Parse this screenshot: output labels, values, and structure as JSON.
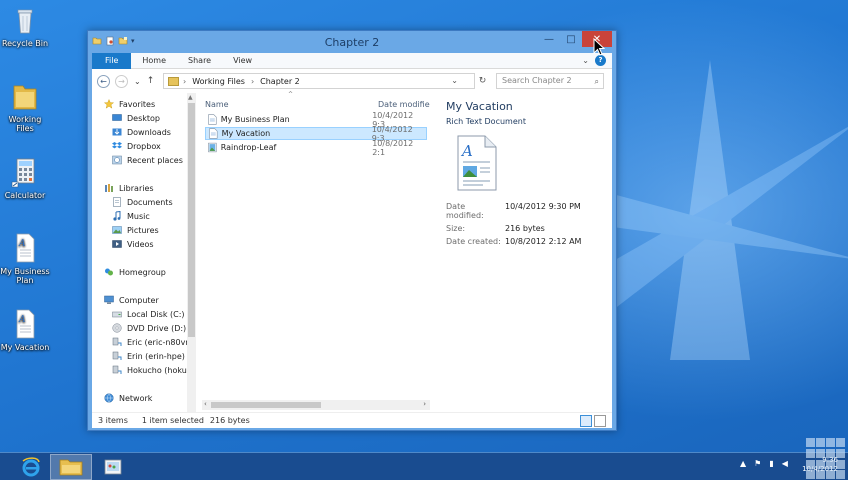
{
  "desktop": {
    "icons": [
      {
        "label": "Recycle Bin"
      },
      {
        "label": "Working Files"
      },
      {
        "label": "Calculator"
      },
      {
        "label": "My Business Plan"
      },
      {
        "label": "My Vacation"
      }
    ]
  },
  "window": {
    "title": "Chapter 2",
    "minimize": "—",
    "maximize": "□",
    "close": "✕"
  },
  "ribbon": {
    "tabs": [
      "File",
      "Home",
      "Share",
      "View"
    ],
    "expand": "⌄",
    "help": "?"
  },
  "address": {
    "back": "←",
    "forward": "→",
    "recent": "⌄",
    "up": "↑",
    "crumbs": [
      "Working Files",
      "Chapter 2"
    ],
    "separator": "›",
    "dropdown": "⌄",
    "refresh": "↻",
    "search_placeholder": "Search Chapter 2",
    "search_icon": "⌕"
  },
  "nav": {
    "favorites": "Favorites",
    "favorites_items": [
      "Desktop",
      "Downloads",
      "Dropbox",
      "Recent places"
    ],
    "libraries": "Libraries",
    "libraries_items": [
      "Documents",
      "Music",
      "Pictures",
      "Videos"
    ],
    "homegroup": "Homegroup",
    "computer": "Computer",
    "computer_items": [
      "Local Disk (C:)",
      "DVD Drive (D:) O!",
      "Eric (eric-n80vn)",
      "Erin (erin-hpe)",
      "Hokucho (hokuc"
    ],
    "network": "Network",
    "scroll_up": "▲"
  },
  "files": {
    "col_name": "Name",
    "col_date": "Date modifie",
    "sort_glyph": "^",
    "rows": [
      {
        "name": "My Business Plan",
        "date": "10/4/2012 9:3"
      },
      {
        "name": "My Vacation",
        "date": "10/4/2012 9:3"
      },
      {
        "name": "Raindrop-Leaf",
        "date": "10/8/2012 2:1"
      }
    ],
    "scroll_left": "‹",
    "scroll_right": "›"
  },
  "preview": {
    "title": "My Vacation",
    "type": "Rich Text Document",
    "props": [
      {
        "k": "Date modified:",
        "v": "10/4/2012 9:30 PM"
      },
      {
        "k": "Size:",
        "v": "216 bytes"
      },
      {
        "k": "Date created:",
        "v": "10/8/2012 2:12 AM"
      }
    ]
  },
  "status": {
    "items": "3 items",
    "selected": "1 item selected",
    "size": "216 bytes"
  },
  "taskbar": {
    "clock_time": "9:36",
    "clock_date": "10/4/2012"
  }
}
